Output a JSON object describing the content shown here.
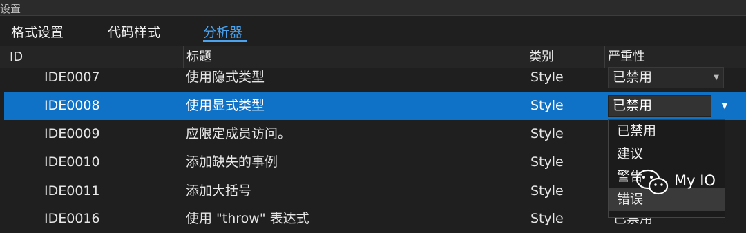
{
  "window": {
    "title": "设置"
  },
  "tabs": [
    {
      "label": "格式设置"
    },
    {
      "label": "代码样式"
    },
    {
      "label": "分析器",
      "active": true
    }
  ],
  "table": {
    "columns": [
      "ID",
      "标题",
      "类别",
      "严重性"
    ],
    "rows": [
      {
        "id": "IDE0007",
        "title": "使用隐式类型",
        "category": "Style",
        "severity": "已禁用"
      },
      {
        "id": "IDE0008",
        "title": "使用显式类型",
        "category": "Style",
        "severity": "已禁用",
        "selected": true
      },
      {
        "id": "IDE0009",
        "title": "应限定成员访问。",
        "category": "Style"
      },
      {
        "id": "IDE0010",
        "title": "添加缺失的事例",
        "category": "Style"
      },
      {
        "id": "IDE0011",
        "title": "添加大括号",
        "category": "Style"
      },
      {
        "id": "IDE0016",
        "title": "使用 \"throw\" 表达式",
        "category": "Style",
        "severity": "已禁用"
      }
    ]
  },
  "severity_dropdown": {
    "options": [
      "已禁用",
      "建议",
      "警告",
      "错误"
    ],
    "highlighted": "错误"
  },
  "watermark": {
    "text": "My IO",
    "icon": "wechat-icon"
  },
  "colors": {
    "background": "#1f1f1f",
    "selection": "#0f72c6",
    "accent": "#4aa3f0"
  }
}
